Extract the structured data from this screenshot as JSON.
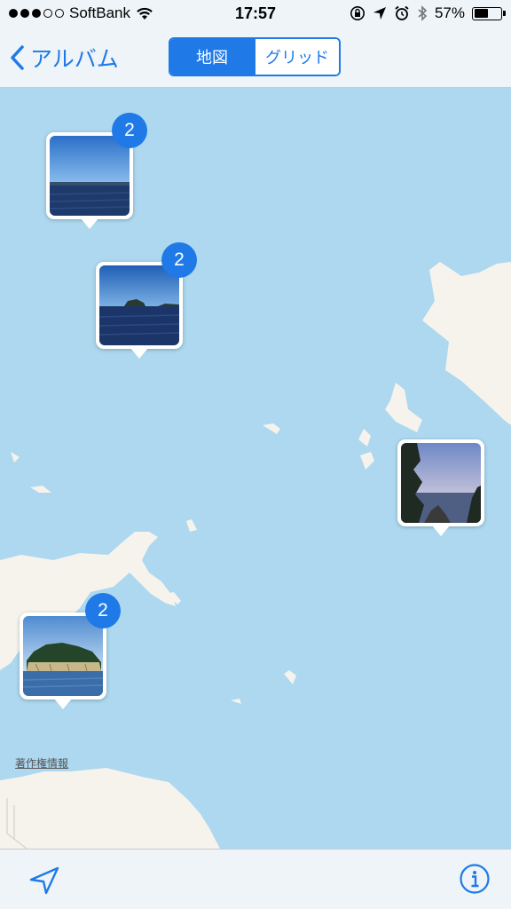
{
  "status_bar": {
    "carrier": "SoftBank",
    "time": "17:57",
    "battery_percent": "57%",
    "battery_level": 0.57,
    "signal_bars_filled": 3,
    "signal_bars_total": 5
  },
  "nav": {
    "back_label": "アルバム",
    "segments": [
      "地図",
      "グリッド"
    ],
    "selected_segment": "地図"
  },
  "map": {
    "pins": [
      {
        "count": "2",
        "icon": "photo-thumbnail"
      },
      {
        "count": "2",
        "icon": "photo-thumbnail"
      },
      {
        "count": "",
        "icon": "photo-thumbnail"
      },
      {
        "count": "2",
        "icon": "photo-thumbnail"
      }
    ],
    "legal_label": "著作権情報"
  },
  "toolbar": {
    "locate_icon": "location-arrow-icon",
    "info_icon": "info-icon"
  },
  "colors": {
    "accent": "#1f7ae8",
    "water": "#add8ef",
    "land": "#f6f3ed",
    "bar_background": "#eef4f8"
  }
}
